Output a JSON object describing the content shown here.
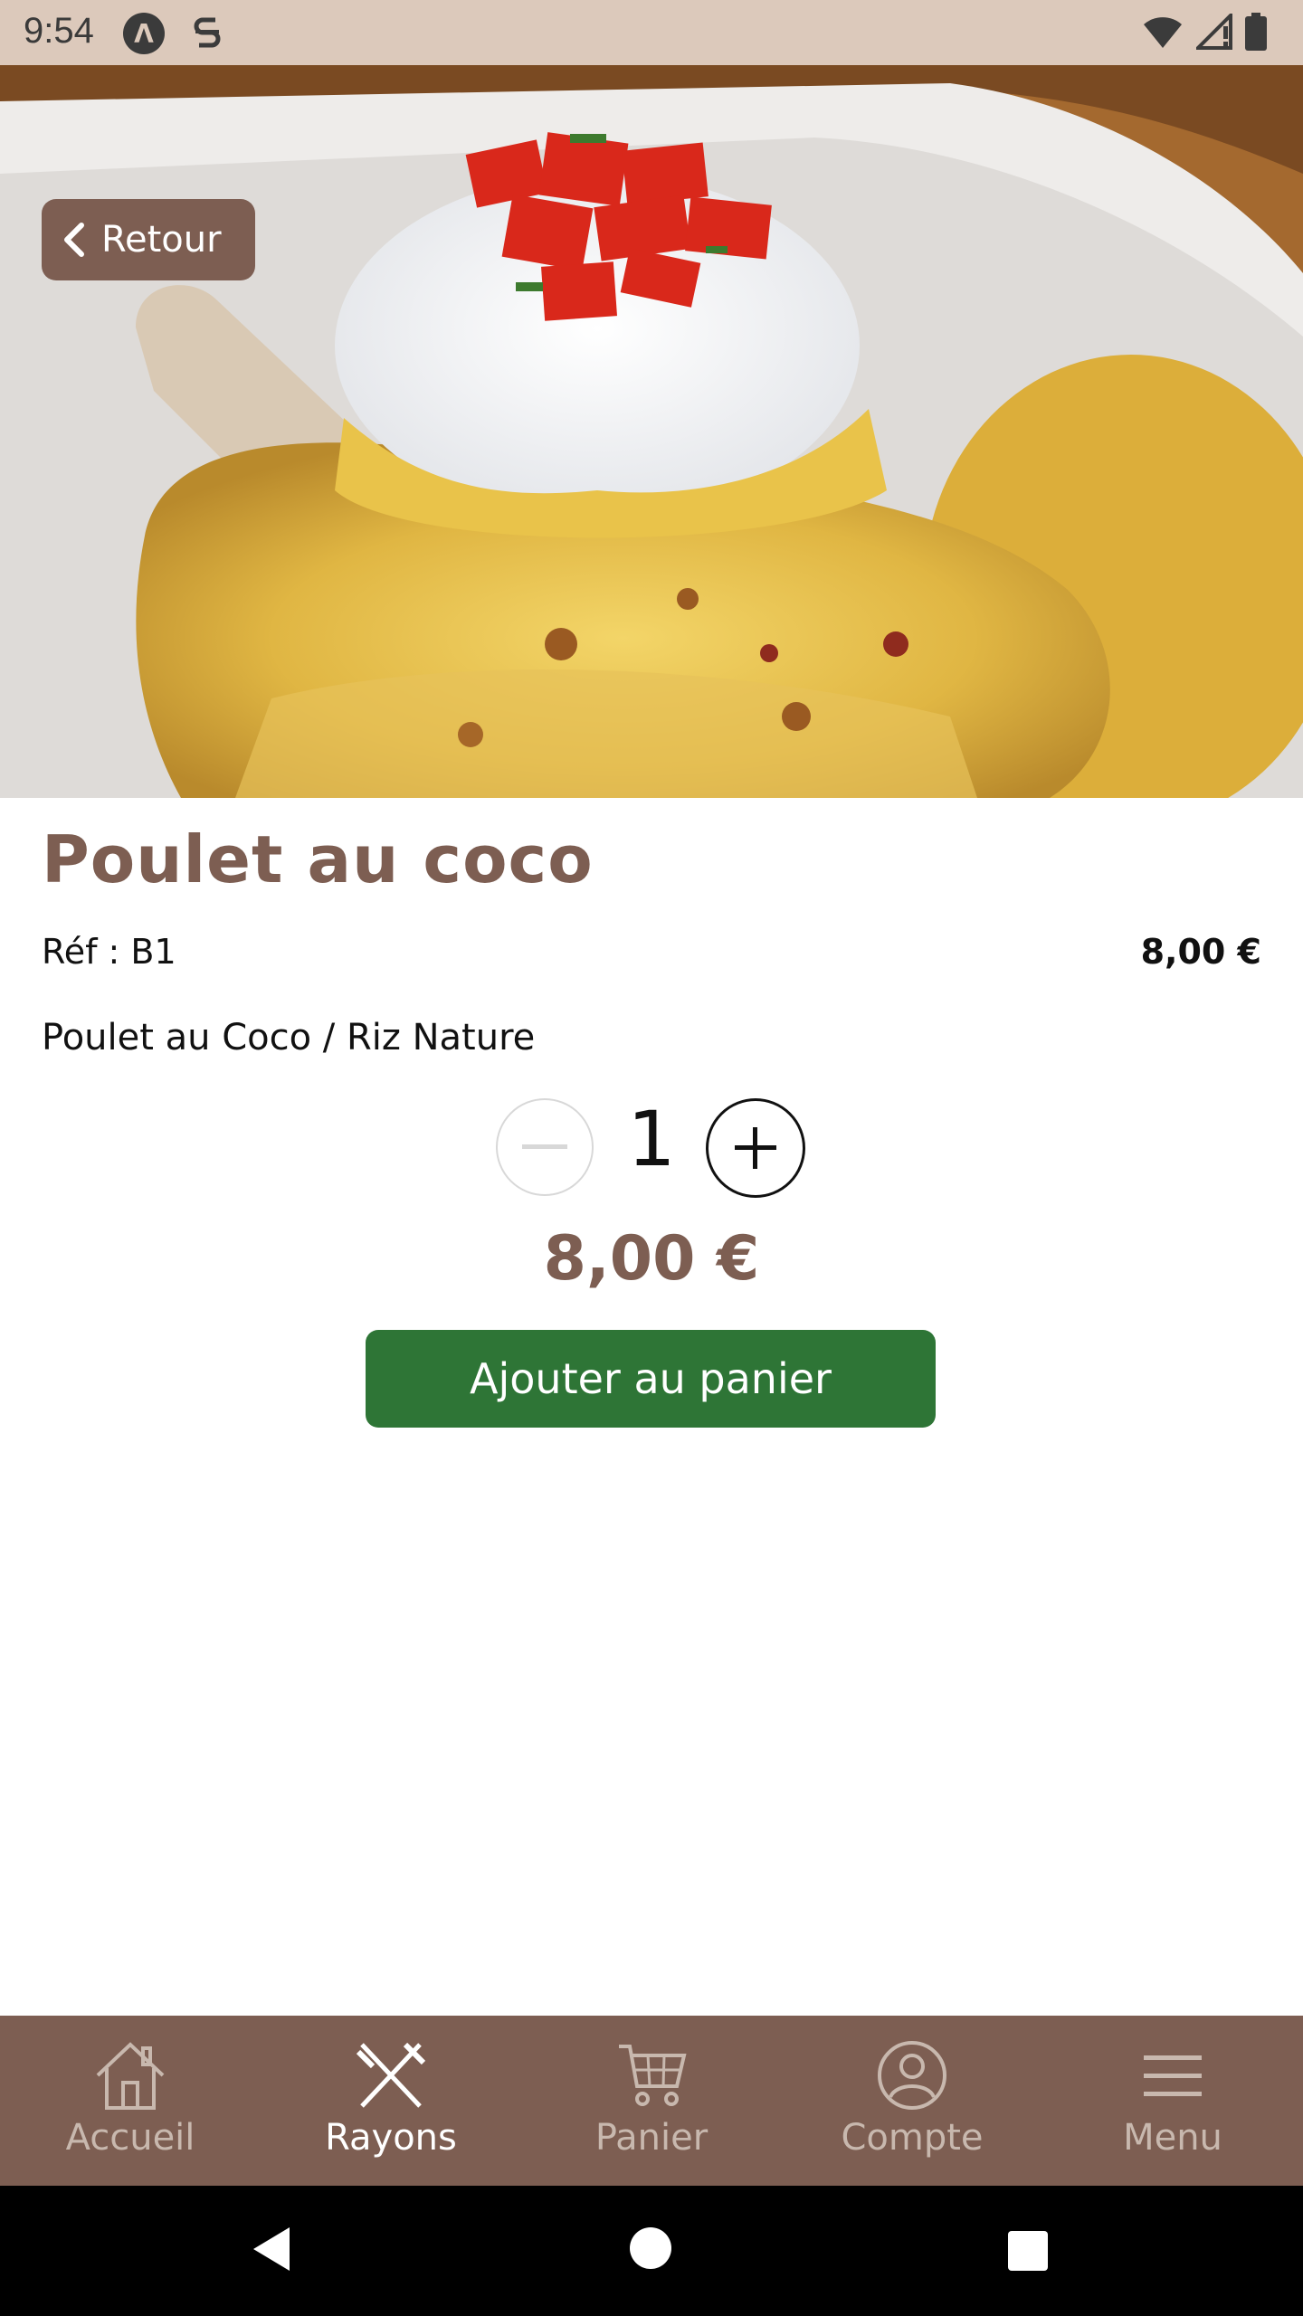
{
  "status_bar": {
    "time": "9:54",
    "icons": [
      "app-a-icon",
      "app-s-icon",
      "wifi-icon",
      "signal-icon",
      "battery-icon"
    ]
  },
  "hero": {
    "back_label": "Retour",
    "image_description_icon": "food-photo"
  },
  "product": {
    "title": "Poulet au coco",
    "ref": "Réf : B1",
    "price": "8,00 €",
    "description": "Poulet au Coco / Riz Nature",
    "quantity": "1",
    "total_price": "8,00 €",
    "add_to_cart_label": "Ajouter au panier"
  },
  "bottom_nav": {
    "items": [
      {
        "label": "Accueil",
        "icon": "home-icon",
        "active": false
      },
      {
        "label": "Rayons",
        "icon": "utensils-icon",
        "active": true
      },
      {
        "label": "Panier",
        "icon": "cart-icon",
        "active": false
      },
      {
        "label": "Compte",
        "icon": "user-icon",
        "active": false
      },
      {
        "label": "Menu",
        "icon": "hamburger-icon",
        "active": false
      }
    ]
  },
  "colors": {
    "brand": "#7d5e52",
    "button_green": "#2e7536",
    "status_bar": "#dcc9bb"
  }
}
